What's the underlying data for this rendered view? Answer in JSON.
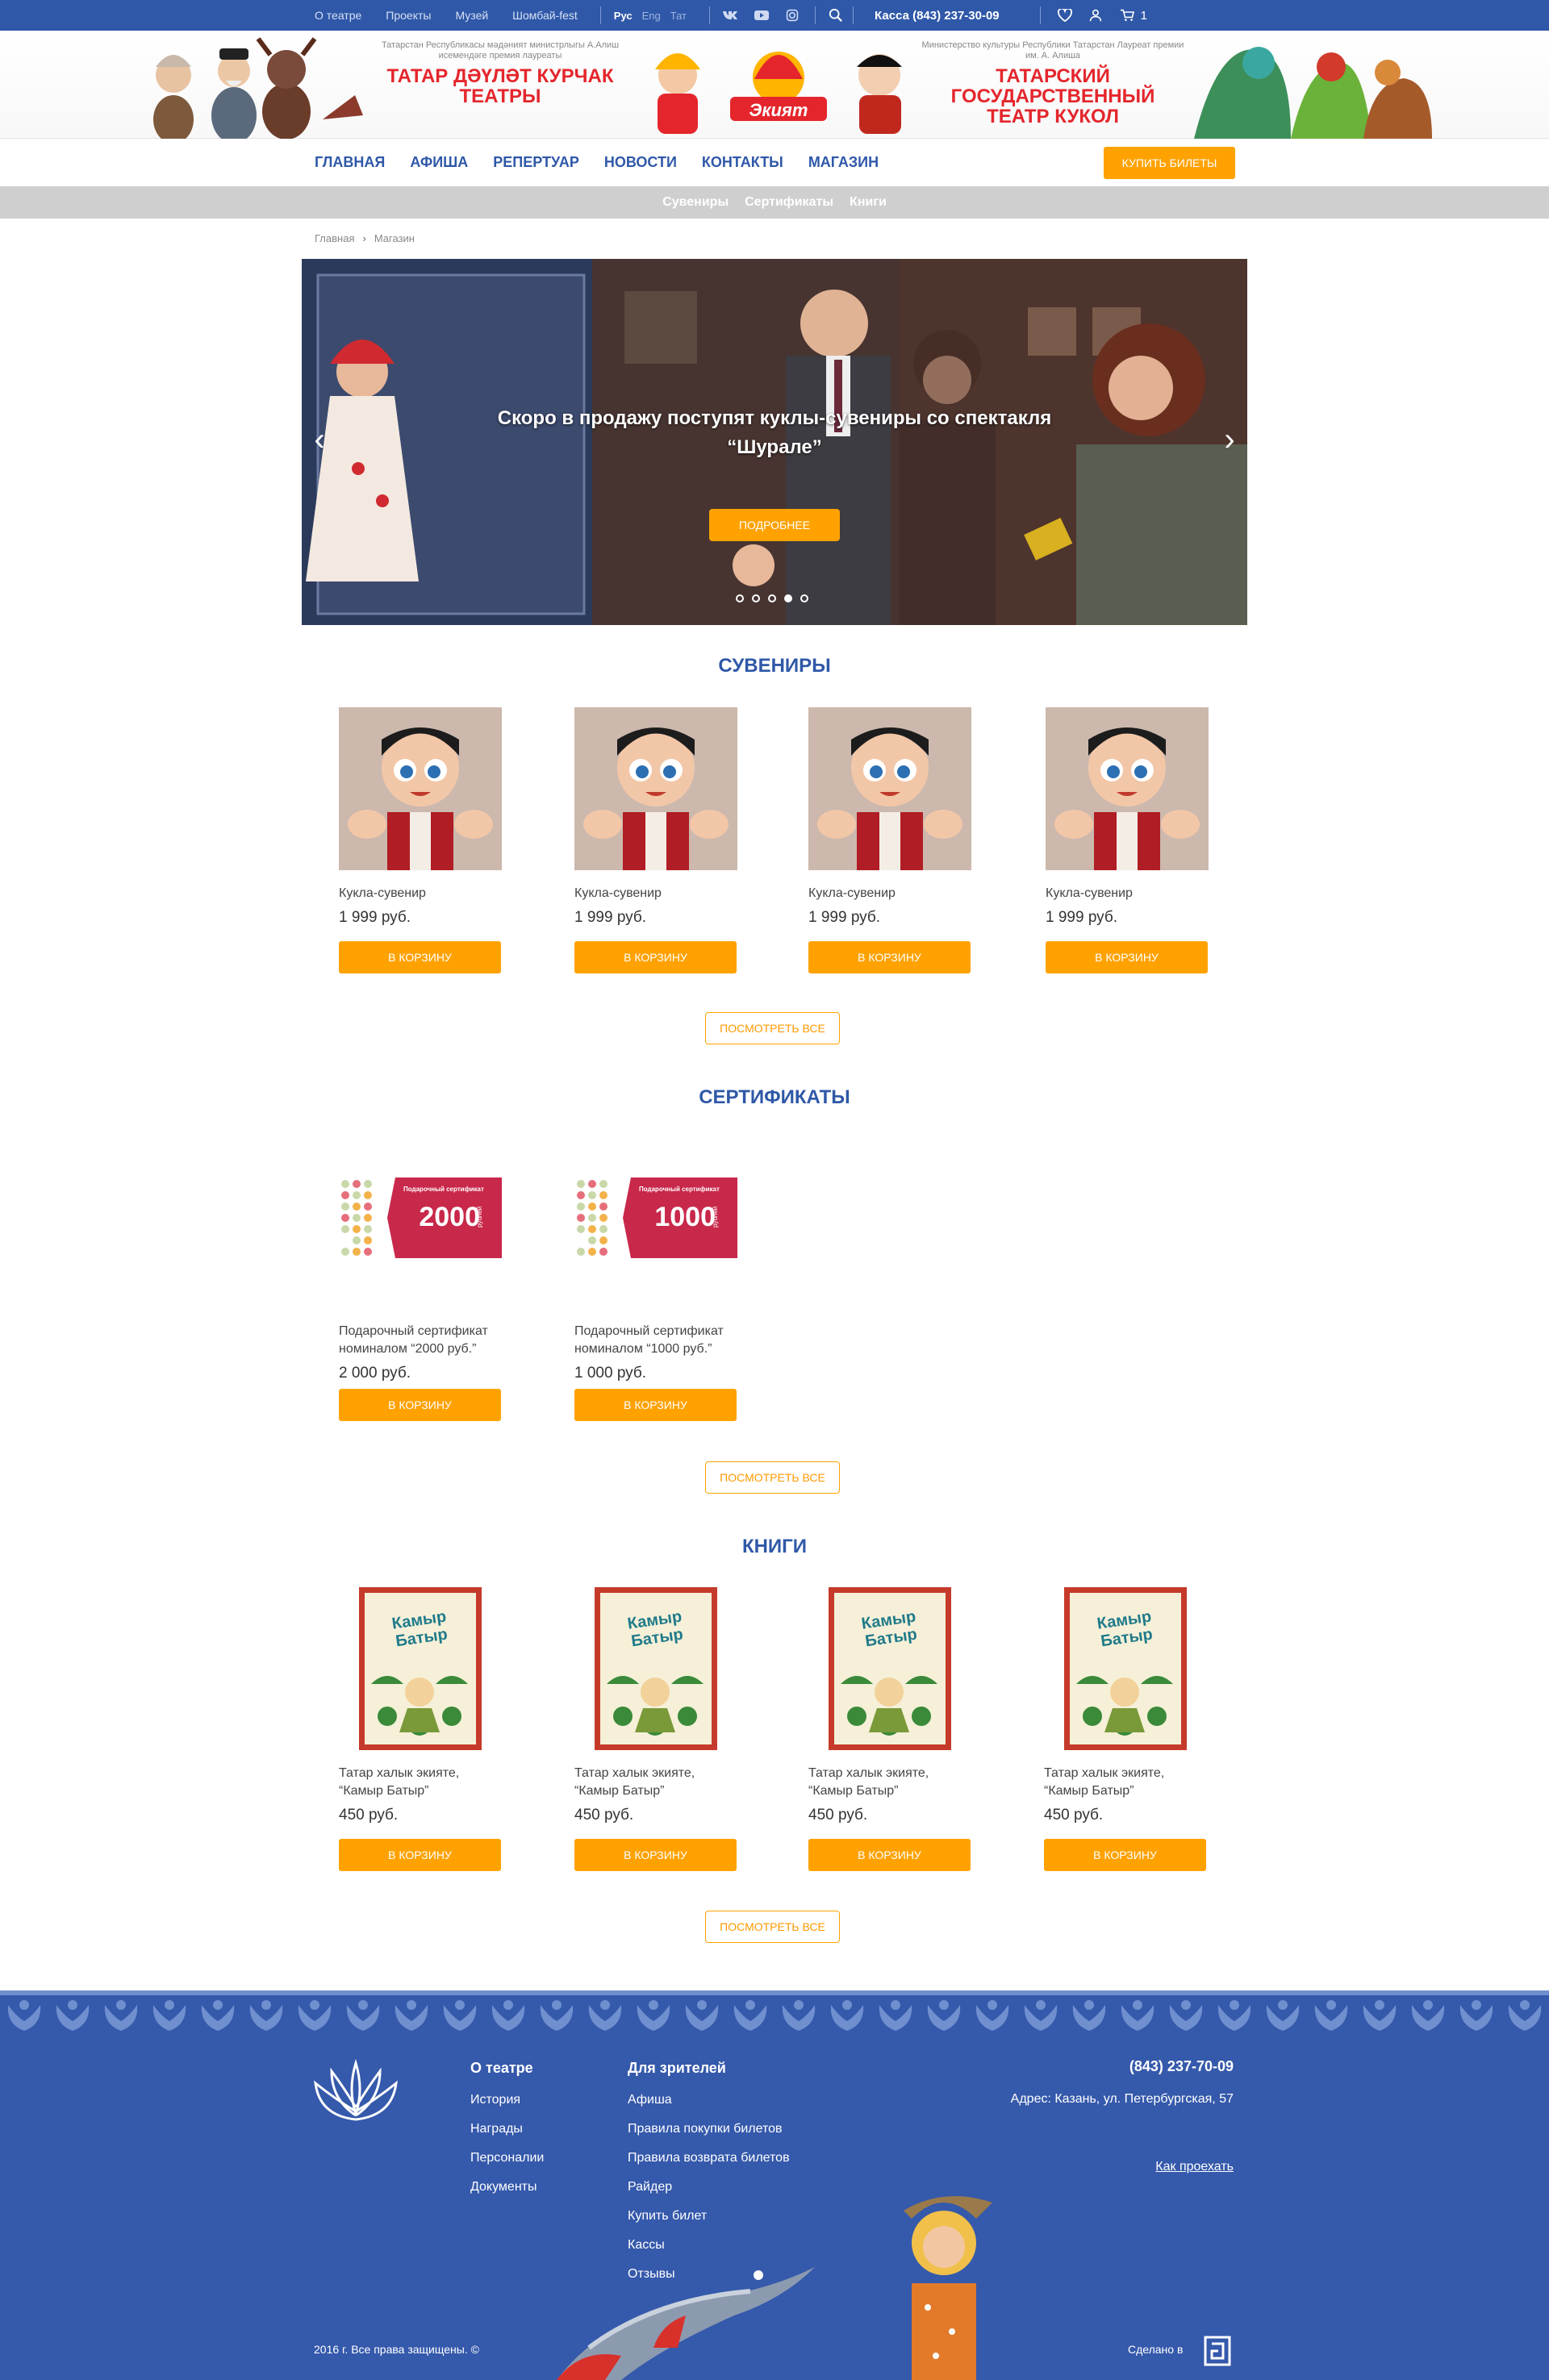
{
  "topbar": {
    "links": [
      "О театре",
      "Проекты",
      "Музей",
      "Шомбай-fest"
    ],
    "langs": [
      "Рус",
      "Eng",
      "Тат"
    ],
    "kassa": "Касса (843) 237-30-09",
    "cart_count": "1"
  },
  "banner": {
    "tat_sub": "Татарстан Республикасы мәдәният министрлыгы А.Алиш исемендәге премия лауреаты",
    "tat_title": "ТАТАР ДӘҮЛӘТ КУРЧАК ТЕАТРЫ",
    "logo": "Экият",
    "ru_sub": "Министерство культуры Республики Татарстан Лауреат премии им. А. Алиша",
    "ru_title": "ТАТАРСКИЙ ГОСУДАРСТВЕННЫЙ ТЕАТР КУКОЛ"
  },
  "nav": {
    "items": [
      "ГЛАВНАЯ",
      "АФИША",
      "РЕПЕРТУАР",
      "НОВОСТИ",
      "КОНТАКТЫ",
      "МАГАЗИН"
    ],
    "buy": "КУПИТЬ БИЛЕТЫ"
  },
  "subnav": [
    "Сувениры",
    "Сертификаты",
    "Книги"
  ],
  "breadcrumb": [
    "Главная",
    "Магазин"
  ],
  "slider": {
    "text": "Скоро в продажу поступят куклы-сувениры со спектакля “Шурале”",
    "button": "ПОДРОБНЕЕ",
    "dots": 5,
    "active_dot": 4
  },
  "sections": {
    "souvenirs": {
      "title": "СУВЕНИРЫ",
      "items": [
        {
          "name": "Кукла-сувенир",
          "price": "1 999 руб."
        },
        {
          "name": "Кукла-сувенир",
          "price": "1 999 руб."
        },
        {
          "name": "Кукла-сувенир",
          "price": "1 999 руб."
        },
        {
          "name": "Кукла-сувенир",
          "price": "1 999 руб."
        }
      ]
    },
    "certificates": {
      "title": "СЕРТИФИКАТЫ",
      "items": [
        {
          "name": "Подарочный сертификат номиналом “2000 руб.”",
          "price": "2 000 руб.",
          "label": "Подарочный сертификат",
          "value": "2000",
          "unit": "рублей"
        },
        {
          "name": "Подарочный сертификат номиналом “1000 руб.”",
          "price": "1 000 руб.",
          "label": "Подарочный сертификат",
          "value": "1000",
          "unit": "рублей"
        }
      ]
    },
    "books": {
      "title": "КНИГИ",
      "items": [
        {
          "name": "Татар халык экияте, “Камыр Батыр”",
          "price": "450 руб.",
          "cover": "Камыр Батыр"
        },
        {
          "name": "Татар халык экияте, “Камыр Батыр”",
          "price": "450 руб.",
          "cover": "Камыр Батыр"
        },
        {
          "name": "Татар халык экияте, “Камыр Батыр”",
          "price": "450 руб.",
          "cover": "Камыр Батыр"
        },
        {
          "name": "Татар халык экияте, “Камыр Батыр”",
          "price": "450 руб.",
          "cover": "Камыр Батыр"
        }
      ]
    },
    "cart_label": "В КОРЗИНУ",
    "view_all": "ПОСМОТРЕТЬ ВСЕ"
  },
  "footer": {
    "col1": {
      "title": "О театре",
      "links": [
        "История",
        "Награды",
        "Персоналии",
        "Документы"
      ]
    },
    "col2": {
      "title": "Для зрителей",
      "links": [
        "Афиша",
        "Правила покупки билетов",
        "Правила возврата билетов",
        "Райдер",
        "Купить билет",
        "Кассы",
        "Отзывы"
      ]
    },
    "phone": "(843) 237-70-09",
    "address": "Адрес: Казань, ул. Петербургская, 57",
    "directions": "Как проехать",
    "copyright": "2016 г. Все права защищены. ©",
    "made_in": "Сделано в"
  },
  "colors": {
    "primary": "#2f58a8",
    "accent": "#ffa200",
    "red": "#e4262c",
    "footer": "#3559ab"
  }
}
